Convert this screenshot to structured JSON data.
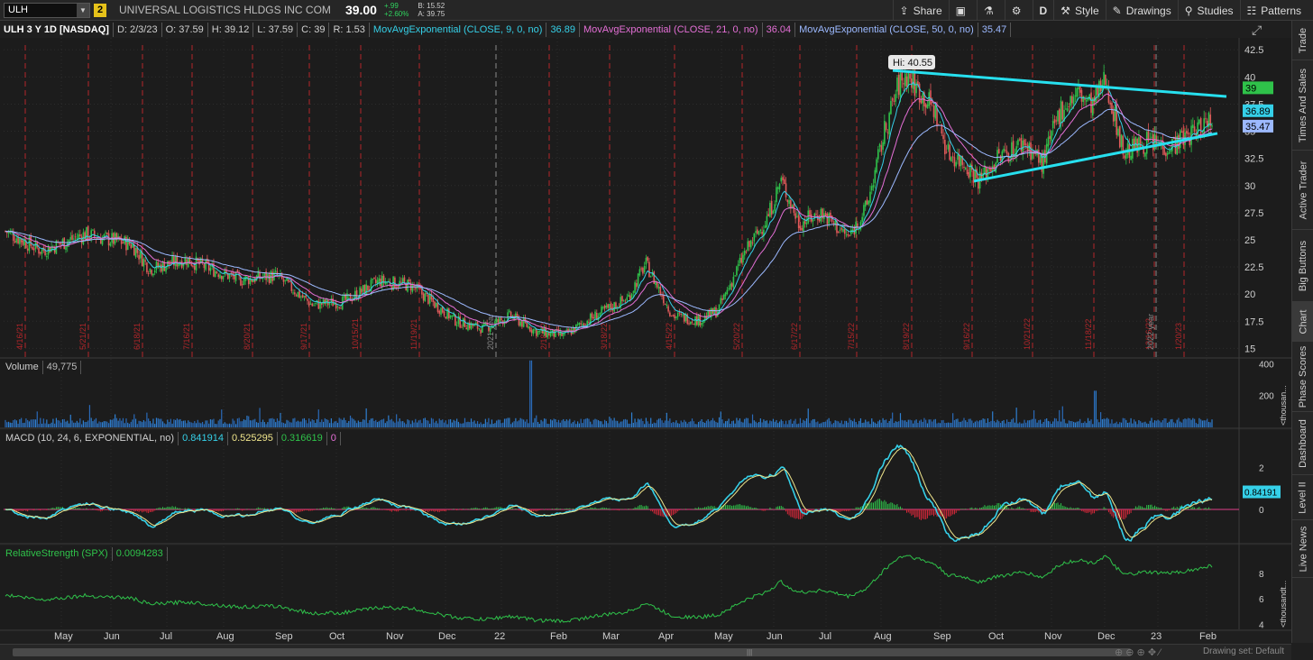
{
  "header": {
    "symbol": "ULH",
    "link_group": "2",
    "company": "UNIVERSAL LOGISTICS HLDGS INC COM",
    "last": "39.00",
    "change": "+.99",
    "change_pct": "+2.60%",
    "bid": "B: 15.52",
    "ask": "A: 39.75",
    "buttons": {
      "share": "Share",
      "aggregation": "D",
      "style": "Style",
      "drawings": "Drawings",
      "studies": "Studies",
      "patterns": "Patterns"
    }
  },
  "info": {
    "symbol_desc": "ULH 3 Y 1D [NASDAQ]",
    "date": "D: 2/3/23",
    "open": "O: 37.59",
    "high": "H: 39.12",
    "low": "L: 37.59",
    "close": "C: 39",
    "range": "R: 1.53",
    "ema9_label": "MovAvgExponential (CLOSE, 9, 0, no)",
    "ema9_value": "36.89",
    "ema21_label": "MovAvgExponential (CLOSE, 21, 0, no)",
    "ema21_value": "36.04",
    "ema50_label": "MovAvgExponential (CLOSE, 50, 0, no)",
    "ema50_value": "35.47"
  },
  "price_axis": [
    "42.5",
    "40",
    "37.5",
    "35",
    "32.5",
    "30",
    "27.5",
    "25",
    "22.5",
    "20",
    "17.5",
    "15"
  ],
  "price_tags": {
    "last": "39",
    "ema9": "36.89",
    "ema50": "35.47"
  },
  "hi_label": "Hi: 40.55",
  "colors": {
    "up": "#2fc24a",
    "down": "#e05a5a",
    "ema9": "#35d0e8",
    "ema21": "#e46fd6",
    "ema50": "#9cb9ff",
    "trendline": "#27e0ef",
    "macd_line": "#35d0e8",
    "signal_line": "#f0e68c",
    "rs_line": "#2fc24a"
  },
  "event_labels": [
    "4/16/21",
    "5/21/21",
    "6/18/21",
    "7/16/21",
    "8/20/21",
    "9/17/21",
    "10/15/21",
    "11/19/21",
    "2021 year",
    "2/18/22",
    "3/18/22",
    "4/15/22",
    "5/20/22",
    "6/17/22",
    "7/15/22",
    "8/19/22",
    "9/16/22",
    "10/21/22",
    "11/18/22",
    "12/16/22",
    "2022 year",
    "1/20/23"
  ],
  "volume": {
    "label": "Volume",
    "value": "49,775",
    "axis": [
      "400",
      "200"
    ],
    "unit": "<thousan..."
  },
  "macd": {
    "label": "MACD (10, 24, 6, EXPONENTIAL, no)",
    "value": "0.841914",
    "avg": "0.525295",
    "diff": "0.316619",
    "zero": "0",
    "axis": [
      "2",
      "0"
    ],
    "tag": "0.84191"
  },
  "rs": {
    "label": "RelativeStrength (SPX)",
    "value": "0.0094283",
    "axis": [
      "8",
      "6",
      "4"
    ],
    "unit": "<thousandt..."
  },
  "x_axis": [
    "May",
    "Jun",
    "Jul",
    "Aug",
    "Sep",
    "Oct",
    "Nov",
    "Dec",
    "22",
    "Feb",
    "Mar",
    "Apr",
    "May",
    "Jun",
    "Jul",
    "Aug",
    "Sep",
    "Oct",
    "Nov",
    "Dec",
    "23",
    "Feb"
  ],
  "sidebar_tabs": [
    "Trade",
    "Times And Sales",
    "Active Trader",
    "Big Buttons",
    "Chart",
    "Phase Scores",
    "Dashboard",
    "Level II",
    "Live News"
  ],
  "footer": {
    "drawing_set": "Drawing set: Default"
  }
}
